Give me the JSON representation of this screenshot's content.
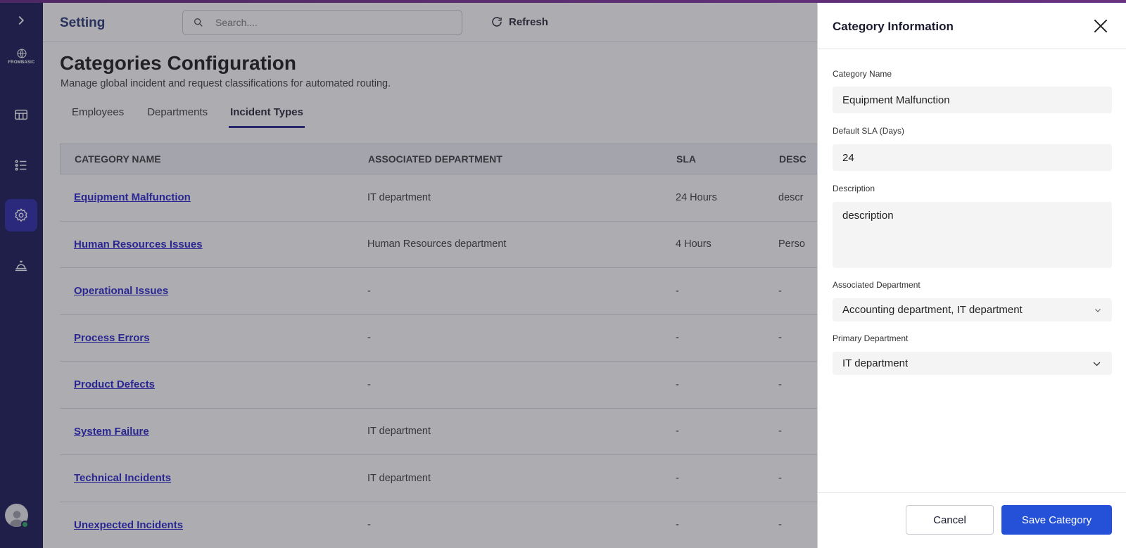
{
  "header": {
    "app_title": "Setting",
    "search_placeholder": "Search....",
    "refresh_label": "Refresh"
  },
  "sidebar": {
    "logo_text": "FROMBASIC",
    "items": [
      {
        "icon": "chevron-right-icon"
      },
      {
        "icon": "dashboard-icon"
      },
      {
        "icon": "list-icon"
      },
      {
        "icon": "gear-icon",
        "active": true
      },
      {
        "icon": "service-bell-icon"
      }
    ],
    "status_color": "#1fa35a"
  },
  "page": {
    "title": "Categories Configuration",
    "subtitle": "Manage global incident and request classifications for automated routing."
  },
  "tabs": [
    {
      "label": "Employees"
    },
    {
      "label": "Departments"
    },
    {
      "label": "Incident Types",
      "active": true
    }
  ],
  "table": {
    "headers": [
      "CATEGORY NAME",
      "ASSOCIATED DEPARTMENT",
      "SLA",
      "DESC"
    ],
    "rows": [
      {
        "name": "Equipment Malfunction",
        "department": "IT department",
        "sla": "24 Hours",
        "desc": "descr"
      },
      {
        "name": "Human Resources Issues",
        "department": "Human Resources department",
        "sla": "4 Hours",
        "desc": "Perso"
      },
      {
        "name": "Operational Issues",
        "department": "-",
        "sla": "-",
        "desc": "-"
      },
      {
        "name": "Process Errors",
        "department": "-",
        "sla": "-",
        "desc": "-"
      },
      {
        "name": "Product Defects",
        "department": "-",
        "sla": "-",
        "desc": "-"
      },
      {
        "name": "System Failure",
        "department": "IT department",
        "sla": "-",
        "desc": "-"
      },
      {
        "name": "Technical Incidents",
        "department": "IT department",
        "sla": "-",
        "desc": "-"
      },
      {
        "name": "Unexpected Incidents",
        "department": "-",
        "sla": "-",
        "desc": "-"
      }
    ]
  },
  "drawer": {
    "title": "Category Information",
    "category_name_label": "Category Name",
    "category_name_value": "Equipment Malfunction",
    "sla_label": "Default SLA (Days)",
    "sla_value": "24",
    "description_label": "Description",
    "description_value": "description",
    "associated_label": "Associated Department",
    "associated_value": "Accounting department, IT department",
    "primary_label": "Primary Department",
    "primary_value": "IT department",
    "cancel_label": "Cancel",
    "save_label": "Save Category",
    "accent_color": "#2451d8"
  }
}
